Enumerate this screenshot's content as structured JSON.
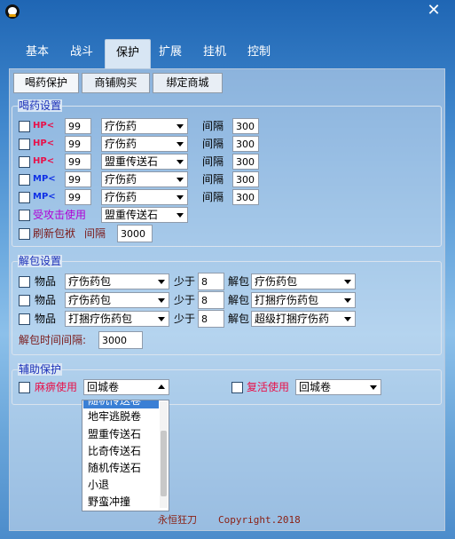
{
  "window": {
    "close_glyph": "✕",
    "icon": "penguin-app-icon"
  },
  "top_tabs": [
    "基本",
    "战斗",
    "保护",
    "扩展",
    "挂机",
    "控制"
  ],
  "sub_tabs": [
    "喝药保护",
    "商铺购买",
    "绑定商城"
  ],
  "drink": {
    "legend": "喝药设置",
    "rows": [
      {
        "tag": "HP<",
        "kind": "hp",
        "value": "99",
        "item": "疗伤药",
        "interval_label": "间隔",
        "interval": "300"
      },
      {
        "tag": "HP<",
        "kind": "hp",
        "value": "99",
        "item": "疗伤药",
        "interval_label": "间隔",
        "interval": "300"
      },
      {
        "tag": "HP<",
        "kind": "hp",
        "value": "99",
        "item": "盟重传送石",
        "interval_label": "间隔",
        "interval": "300"
      },
      {
        "tag": "MP<",
        "kind": "mp",
        "value": "99",
        "item": "疗伤药",
        "interval_label": "间隔",
        "interval": "300"
      },
      {
        "tag": "MP<",
        "kind": "mp",
        "value": "99",
        "item": "疗伤药",
        "interval_label": "间隔",
        "interval": "300"
      }
    ],
    "attacked_label": "受攻击使用",
    "attacked_item": "盟重传送石",
    "refresh_label": "刷新包袱",
    "refresh_interval_label": "间隔",
    "refresh_interval": "3000"
  },
  "unpack": {
    "legend": "解包设置",
    "rows": [
      {
        "label": "物品",
        "item": "疗伤药包",
        "less_label": "少于",
        "count": "8",
        "unpack_label": "解包",
        "result": "疗伤药包"
      },
      {
        "label": "物品",
        "item": "疗伤药包",
        "less_label": "少于",
        "count": "8",
        "unpack_label": "解包",
        "result": "打捆疗伤药包"
      },
      {
        "label": "物品",
        "item": "打捆疗伤药包",
        "less_label": "少于",
        "count": "8",
        "unpack_label": "解包",
        "result": "超级打捆疗伤药"
      }
    ],
    "interval_label": "解包时间间隔:",
    "interval": "3000"
  },
  "assist": {
    "legend": "辅助保护",
    "paralysis_label": "麻痹使用",
    "paralysis_item": "回城卷",
    "revive_label": "复活使用",
    "revive_item": "回城卷"
  },
  "dropdown": {
    "items": [
      "随机传送卷",
      "地牢逃脱卷",
      "盟重传送石",
      "比奇传送石",
      "随机传送石",
      "小退",
      "野蛮冲撞"
    ]
  },
  "footer": {
    "author": "永恒狂刀",
    "copyright": "Copyright.2018"
  }
}
